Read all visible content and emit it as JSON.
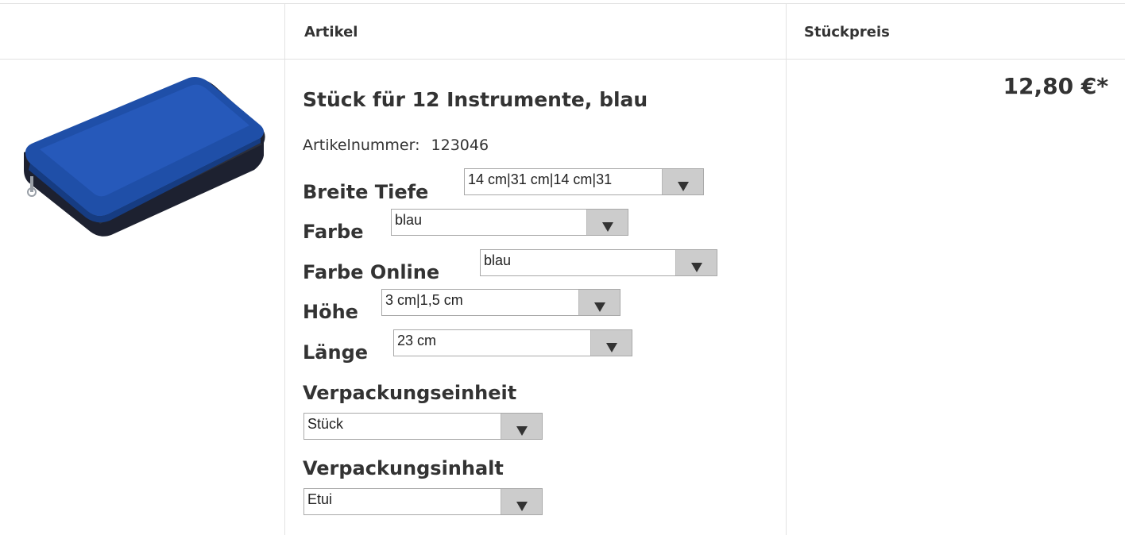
{
  "header": {
    "col_article": "Artikel",
    "col_unit_price": "Stückpreis"
  },
  "product": {
    "image_icon": "pencil-case-image",
    "title": "Stück für 12 Instrumente, blau",
    "article_number_label": "Artikelnummer:",
    "article_number": "123046",
    "price": "12,80 €*"
  },
  "options": [
    {
      "label": "Breite Tiefe",
      "value": "14 cm|31 cm|14 cm|31"
    },
    {
      "label": "Farbe",
      "value": "blau"
    },
    {
      "label": "Farbe Online",
      "value": "blau"
    },
    {
      "label": "Höhe",
      "value": "3 cm|1,5 cm"
    },
    {
      "label": "Länge",
      "value": "23 cm"
    },
    {
      "label": "Verpackungseinheit",
      "value": "Stück"
    },
    {
      "label": "Verpackungsinhalt",
      "value": "Etui"
    }
  ],
  "colors": {
    "case_blue": "#1f4fa8",
    "border_gray": "#e2e2e2",
    "select_button": "#cccccc"
  }
}
